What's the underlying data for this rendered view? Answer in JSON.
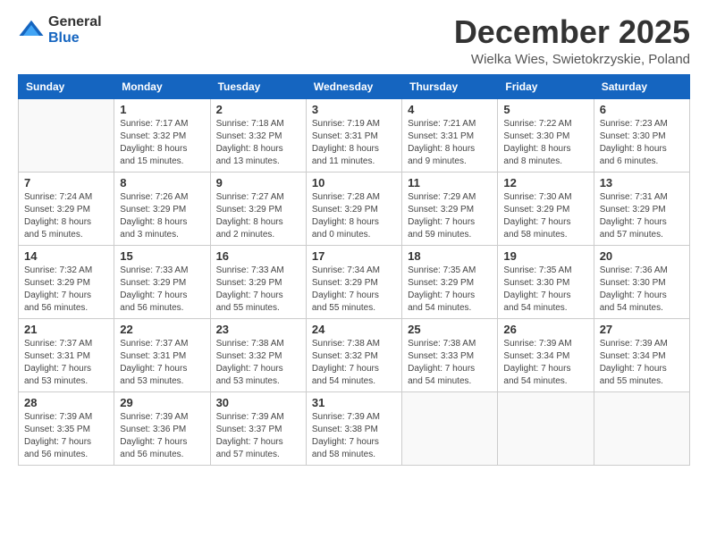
{
  "logo": {
    "general": "General",
    "blue": "Blue"
  },
  "header": {
    "month": "December 2025",
    "location": "Wielka Wies, Swietokrzyskie, Poland"
  },
  "weekdays": [
    "Sunday",
    "Monday",
    "Tuesday",
    "Wednesday",
    "Thursday",
    "Friday",
    "Saturday"
  ],
  "weeks": [
    [
      {
        "day": "",
        "info": ""
      },
      {
        "day": "1",
        "info": "Sunrise: 7:17 AM\nSunset: 3:32 PM\nDaylight: 8 hours\nand 15 minutes."
      },
      {
        "day": "2",
        "info": "Sunrise: 7:18 AM\nSunset: 3:32 PM\nDaylight: 8 hours\nand 13 minutes."
      },
      {
        "day": "3",
        "info": "Sunrise: 7:19 AM\nSunset: 3:31 PM\nDaylight: 8 hours\nand 11 minutes."
      },
      {
        "day": "4",
        "info": "Sunrise: 7:21 AM\nSunset: 3:31 PM\nDaylight: 8 hours\nand 9 minutes."
      },
      {
        "day": "5",
        "info": "Sunrise: 7:22 AM\nSunset: 3:30 PM\nDaylight: 8 hours\nand 8 minutes."
      },
      {
        "day": "6",
        "info": "Sunrise: 7:23 AM\nSunset: 3:30 PM\nDaylight: 8 hours\nand 6 minutes."
      }
    ],
    [
      {
        "day": "7",
        "info": "Sunrise: 7:24 AM\nSunset: 3:29 PM\nDaylight: 8 hours\nand 5 minutes."
      },
      {
        "day": "8",
        "info": "Sunrise: 7:26 AM\nSunset: 3:29 PM\nDaylight: 8 hours\nand 3 minutes."
      },
      {
        "day": "9",
        "info": "Sunrise: 7:27 AM\nSunset: 3:29 PM\nDaylight: 8 hours\nand 2 minutes."
      },
      {
        "day": "10",
        "info": "Sunrise: 7:28 AM\nSunset: 3:29 PM\nDaylight: 8 hours\nand 0 minutes."
      },
      {
        "day": "11",
        "info": "Sunrise: 7:29 AM\nSunset: 3:29 PM\nDaylight: 7 hours\nand 59 minutes."
      },
      {
        "day": "12",
        "info": "Sunrise: 7:30 AM\nSunset: 3:29 PM\nDaylight: 7 hours\nand 58 minutes."
      },
      {
        "day": "13",
        "info": "Sunrise: 7:31 AM\nSunset: 3:29 PM\nDaylight: 7 hours\nand 57 minutes."
      }
    ],
    [
      {
        "day": "14",
        "info": "Sunrise: 7:32 AM\nSunset: 3:29 PM\nDaylight: 7 hours\nand 56 minutes."
      },
      {
        "day": "15",
        "info": "Sunrise: 7:33 AM\nSunset: 3:29 PM\nDaylight: 7 hours\nand 56 minutes."
      },
      {
        "day": "16",
        "info": "Sunrise: 7:33 AM\nSunset: 3:29 PM\nDaylight: 7 hours\nand 55 minutes."
      },
      {
        "day": "17",
        "info": "Sunrise: 7:34 AM\nSunset: 3:29 PM\nDaylight: 7 hours\nand 55 minutes."
      },
      {
        "day": "18",
        "info": "Sunrise: 7:35 AM\nSunset: 3:29 PM\nDaylight: 7 hours\nand 54 minutes."
      },
      {
        "day": "19",
        "info": "Sunrise: 7:35 AM\nSunset: 3:30 PM\nDaylight: 7 hours\nand 54 minutes."
      },
      {
        "day": "20",
        "info": "Sunrise: 7:36 AM\nSunset: 3:30 PM\nDaylight: 7 hours\nand 54 minutes."
      }
    ],
    [
      {
        "day": "21",
        "info": "Sunrise: 7:37 AM\nSunset: 3:31 PM\nDaylight: 7 hours\nand 53 minutes."
      },
      {
        "day": "22",
        "info": "Sunrise: 7:37 AM\nSunset: 3:31 PM\nDaylight: 7 hours\nand 53 minutes."
      },
      {
        "day": "23",
        "info": "Sunrise: 7:38 AM\nSunset: 3:32 PM\nDaylight: 7 hours\nand 53 minutes."
      },
      {
        "day": "24",
        "info": "Sunrise: 7:38 AM\nSunset: 3:32 PM\nDaylight: 7 hours\nand 54 minutes."
      },
      {
        "day": "25",
        "info": "Sunrise: 7:38 AM\nSunset: 3:33 PM\nDaylight: 7 hours\nand 54 minutes."
      },
      {
        "day": "26",
        "info": "Sunrise: 7:39 AM\nSunset: 3:34 PM\nDaylight: 7 hours\nand 54 minutes."
      },
      {
        "day": "27",
        "info": "Sunrise: 7:39 AM\nSunset: 3:34 PM\nDaylight: 7 hours\nand 55 minutes."
      }
    ],
    [
      {
        "day": "28",
        "info": "Sunrise: 7:39 AM\nSunset: 3:35 PM\nDaylight: 7 hours\nand 56 minutes."
      },
      {
        "day": "29",
        "info": "Sunrise: 7:39 AM\nSunset: 3:36 PM\nDaylight: 7 hours\nand 56 minutes."
      },
      {
        "day": "30",
        "info": "Sunrise: 7:39 AM\nSunset: 3:37 PM\nDaylight: 7 hours\nand 57 minutes."
      },
      {
        "day": "31",
        "info": "Sunrise: 7:39 AM\nSunset: 3:38 PM\nDaylight: 7 hours\nand 58 minutes."
      },
      {
        "day": "",
        "info": ""
      },
      {
        "day": "",
        "info": ""
      },
      {
        "day": "",
        "info": ""
      }
    ]
  ]
}
